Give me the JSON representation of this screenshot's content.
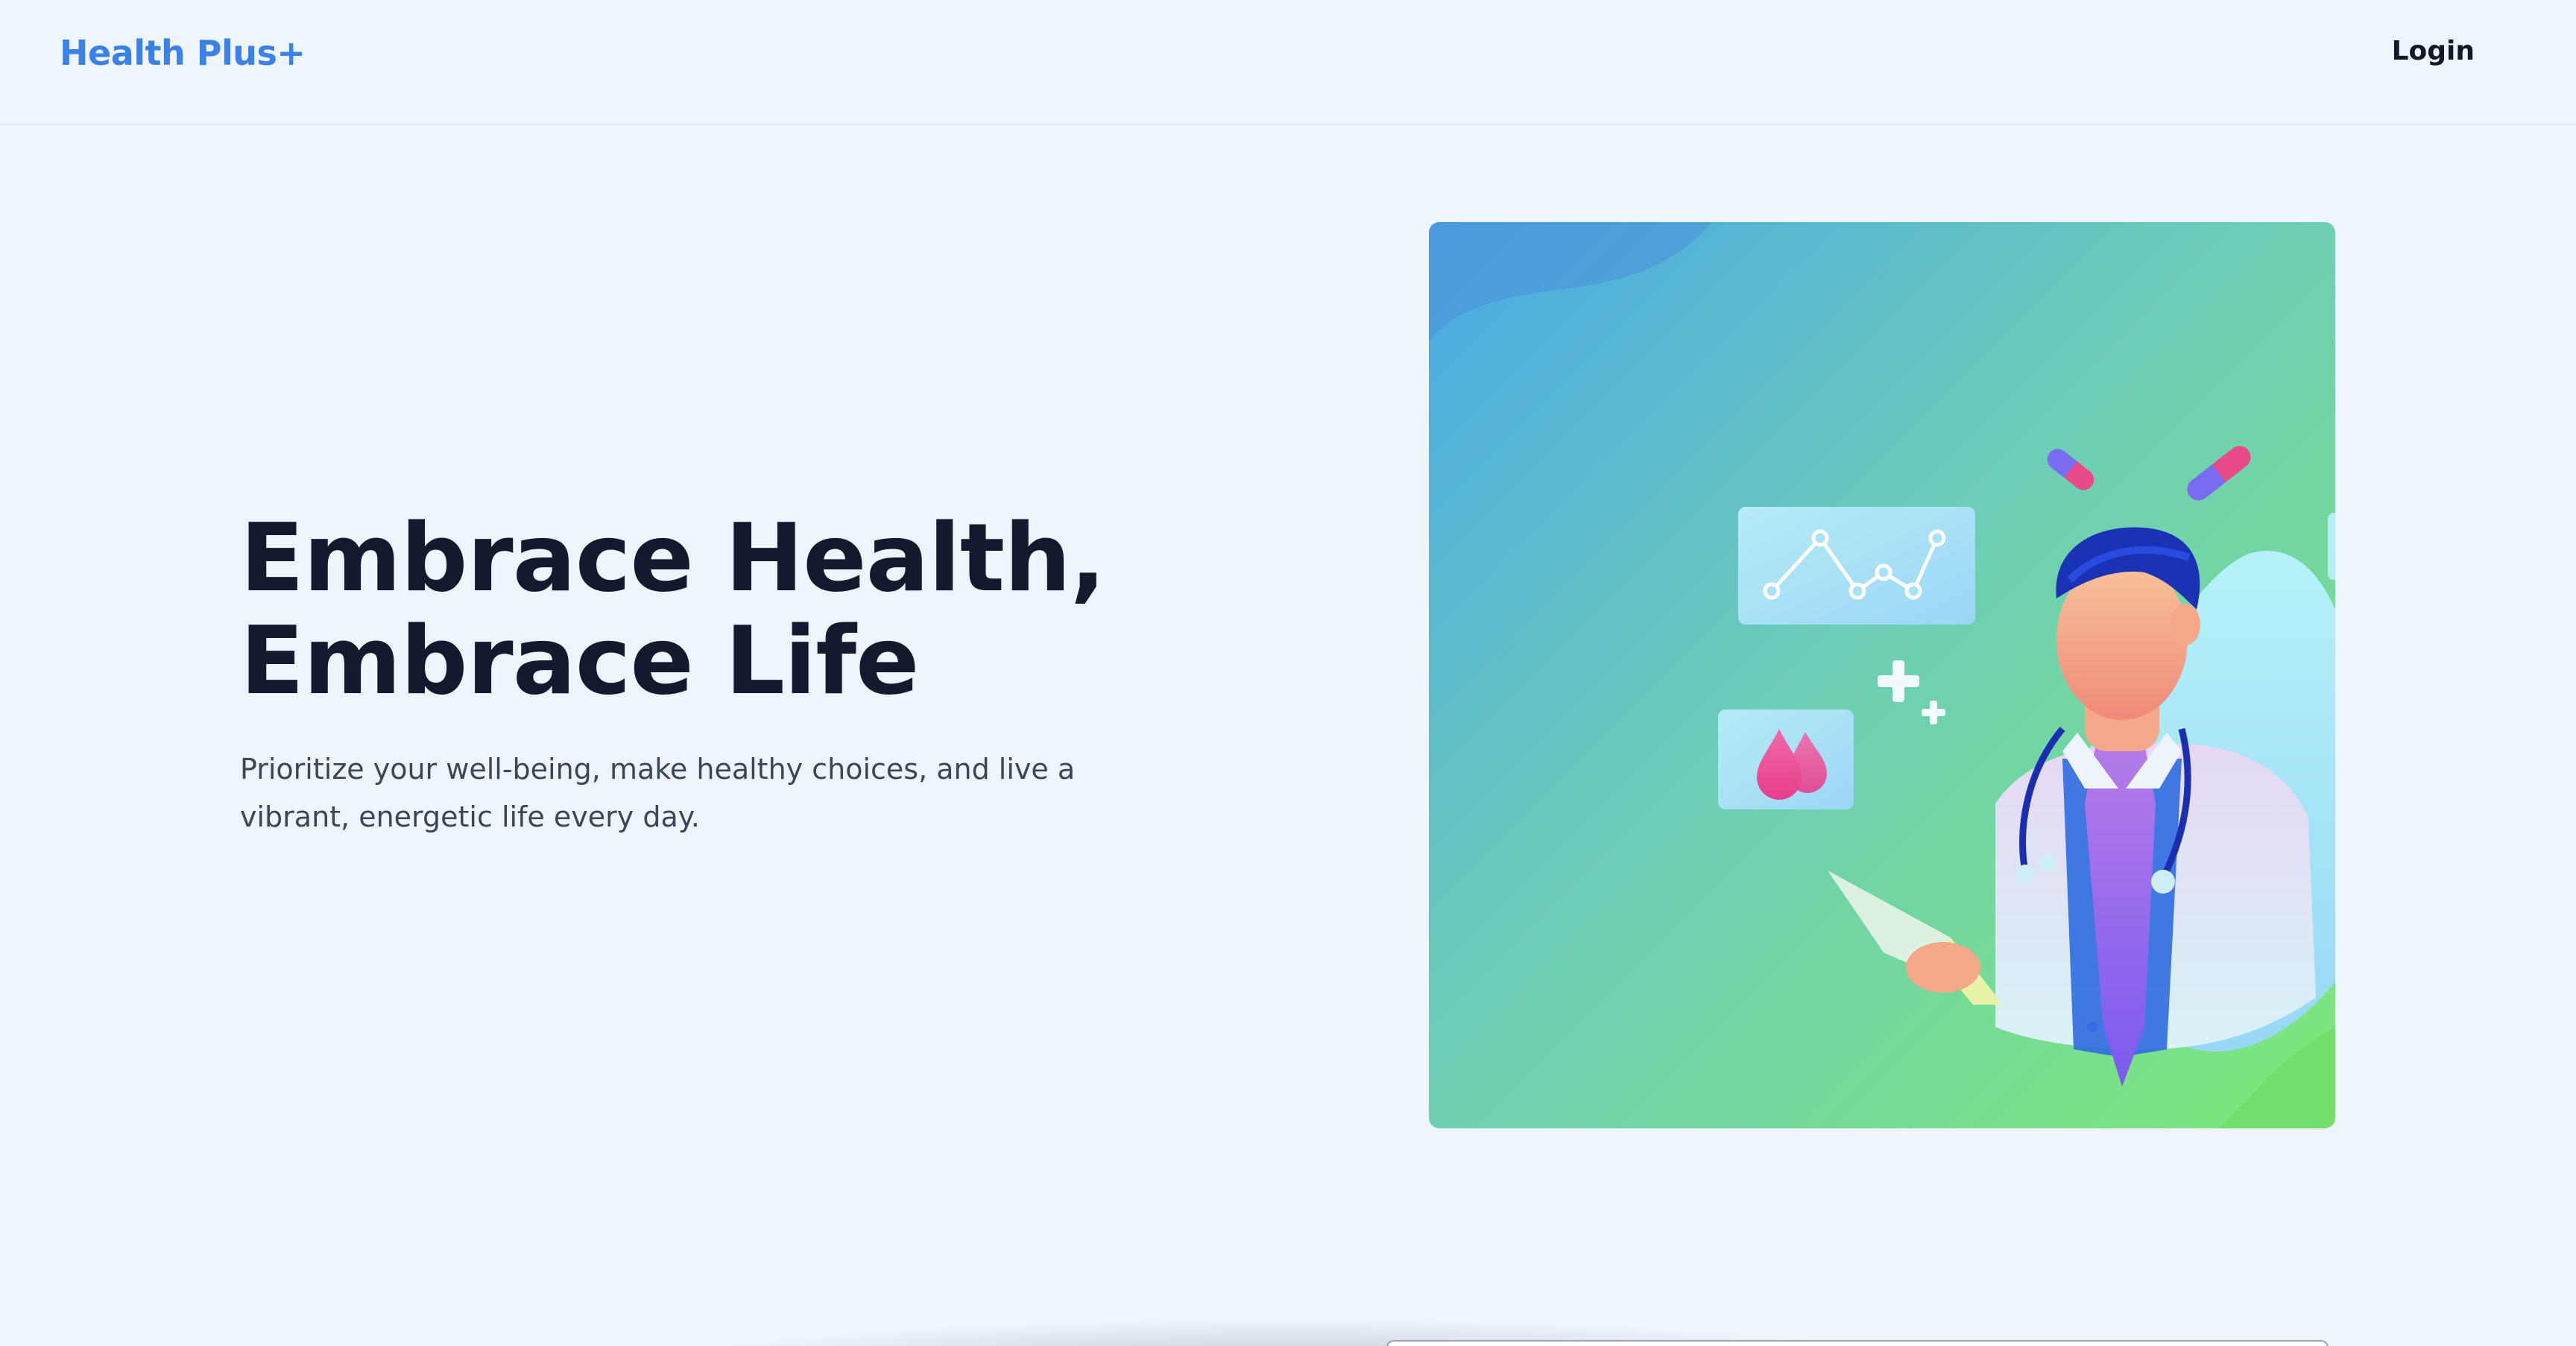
{
  "nav": {
    "brand": "Health Plus+",
    "login_label": "Login"
  },
  "hero": {
    "title_line1": "Embrace Health,",
    "title_line2": "Embrace Life",
    "subtitle": "Prioritize your well-being, make healthy choices, and live a vibrant, energetic life every day."
  },
  "illustration": {
    "subject": "doctor-illustration",
    "icons": [
      "heart-rate-chart-icon",
      "blood-drop-icon",
      "medical-cross-icon",
      "pill-capsule-icon"
    ]
  },
  "colors": {
    "brand": "#3b82e8",
    "heading": "#141a2e",
    "background": "#eef5fd",
    "gradient_start": "#4a90e2",
    "gradient_end": "#7ee87a"
  }
}
